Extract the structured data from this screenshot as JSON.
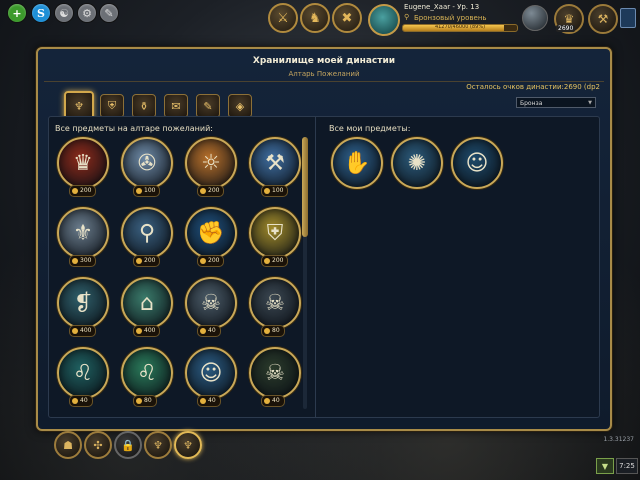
{
  "top_left": {
    "plus": "+",
    "skype": "S",
    "icon_a": "☯",
    "icon_b": "⚙",
    "icon_c": "✎"
  },
  "top_nav": [
    "⚔",
    "♞",
    "✖"
  ],
  "profile": {
    "name": "Eugene_Xaar - Ур. 13",
    "rank_icon": "⚲",
    "rank": "Бронзовый уровень",
    "xp_text": "41270/46000 (89%)",
    "xp_fraction": 0.89
  },
  "top_right": {
    "currency": "2690",
    "buttons": [
      "♛",
      "⚒"
    ]
  },
  "panel": {
    "title": "Хранилище моей династии",
    "subtitle": "Алтарь Пожеланий",
    "points_label": "Осталось очков династии:2690 (dp2",
    "select_value": "Бронза",
    "select_arrow": "▼",
    "tabs": [
      "♆",
      "⛨",
      "⚱",
      "✉",
      "✎",
      "◈"
    ],
    "left_label": "Все предметы на алтаре пожеланий:",
    "right_label": "Все мои предметы:",
    "altar_items": [
      {
        "name": "crown-shield",
        "glyph": "♛",
        "price": "200",
        "bg": "#8c2a1a"
      },
      {
        "name": "compass",
        "glyph": "✇",
        "price": "100",
        "bg": "#6e8aa6"
      },
      {
        "name": "raised-arms",
        "glyph": "☼",
        "price": "200",
        "bg": "#b8702a"
      },
      {
        "name": "hammer",
        "glyph": "⚒",
        "price": "100",
        "bg": "#3f6ea0"
      },
      {
        "name": "bundle",
        "glyph": "⚜",
        "price": "300",
        "bg": "#6a7c8c"
      },
      {
        "name": "magnifier",
        "glyph": "⚲",
        "price": "200",
        "bg": "#3a6080"
      },
      {
        "name": "fist",
        "glyph": "✊",
        "price": "200",
        "bg": "#1f4f7a"
      },
      {
        "name": "shield",
        "glyph": "⛨",
        "price": "200",
        "bg": "#a08a2a"
      },
      {
        "name": "book",
        "glyph": "❡",
        "price": "400",
        "bg": "#2f5f6a"
      },
      {
        "name": "house",
        "glyph": "⌂",
        "price": "400",
        "bg": "#3a7a6a"
      },
      {
        "name": "beast",
        "glyph": "☠",
        "price": "40",
        "bg": "#4a5a66"
      },
      {
        "name": "beast-2",
        "glyph": "☠",
        "price": "80",
        "bg": "#3a4650"
      },
      {
        "name": "lion",
        "glyph": "♌",
        "price": "40",
        "bg": "#1f6060"
      },
      {
        "name": "lion-2",
        "glyph": "♌",
        "price": "80",
        "bg": "#2a7a5a"
      },
      {
        "name": "medusa",
        "glyph": "☺",
        "price": "40",
        "bg": "#2a5a80"
      },
      {
        "name": "skull",
        "glyph": "☠",
        "price": "40",
        "bg": "#2a3a2a"
      }
    ],
    "my_items": [
      {
        "name": "handshake",
        "glyph": "✋",
        "bg": "#2d5f8a"
      },
      {
        "name": "multi-arms",
        "glyph": "✺",
        "bg": "#2b5a7a"
      },
      {
        "name": "medusa",
        "glyph": "☺",
        "bg": "#1e4a6a"
      }
    ]
  },
  "bottom": {
    "buttons": [
      "☗",
      "✣",
      "🔒",
      "♆",
      "♆"
    ],
    "version": "1.3.31237",
    "chat": "▼",
    "time": "7:25"
  }
}
